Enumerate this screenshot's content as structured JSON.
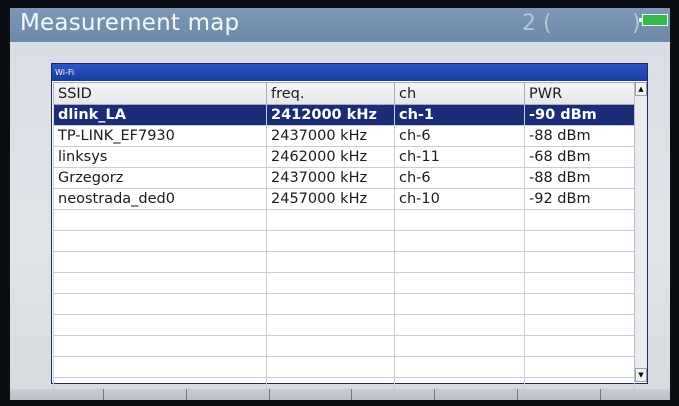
{
  "header": {
    "title": "Measurement map",
    "counter_left": "2 (",
    "counter_right": ")"
  },
  "panel": {
    "title": "Wi-Fi"
  },
  "table": {
    "columns": [
      "SSID",
      "freq.",
      "ch",
      "PWR"
    ],
    "rows": [
      [
        "dlink_LA",
        "2412000 kHz",
        "ch-1",
        "-90 dBm"
      ],
      [
        "TP-LINK_EF7930",
        "2437000 kHz",
        "ch-6",
        "-88 dBm"
      ],
      [
        "linksys",
        "2462000 kHz",
        "ch-11",
        "-68 dBm"
      ],
      [
        "Grzegorz",
        "2437000 kHz",
        "ch-6",
        "-88 dBm"
      ],
      [
        "neostrada_ded0",
        "2457000 kHz",
        "ch-10",
        "-92 dBm"
      ]
    ],
    "selected_row": 0
  },
  "colors": {
    "title_bar": "#6d89a8",
    "panel_header": "#1f45b0",
    "selected_row": "#1b2c79",
    "battery": "#35b94a"
  },
  "icons": {
    "battery": "battery-icon",
    "scroll_up": "scroll-up-arrow-icon",
    "scroll_down": "scroll-down-arrow-icon"
  }
}
